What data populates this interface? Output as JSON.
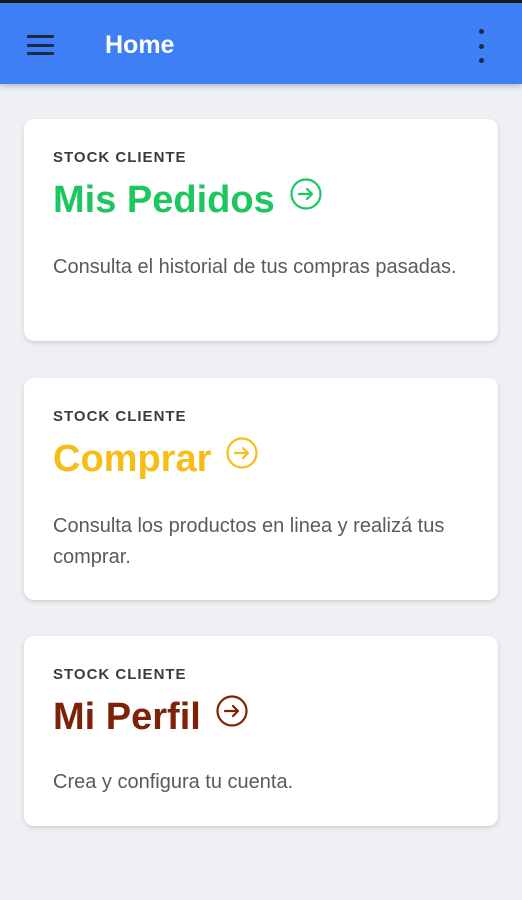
{
  "header": {
    "title": "Home"
  },
  "colors": {
    "appbar": "#3f7ff6",
    "green": "#1ec660",
    "yellow": "#f7bd16",
    "brown": "#7d2208"
  },
  "cards": [
    {
      "overline": "STOCK CLIENTE",
      "title": "Mis Pedidos",
      "description": "Consulta el historial de tus compras pasadas.",
      "color": "#1ec660",
      "icon": "arrow-right-circle-icon"
    },
    {
      "overline": "STOCK CLIENTE",
      "title": "Comprar",
      "description": "Consulta los productos en linea y realizá tus comprar.",
      "color": "#f7bd16",
      "icon": "arrow-right-circle-icon"
    },
    {
      "overline": "STOCK CLIENTE",
      "title": "Mi Perfil",
      "description": "Crea y configura tu cuenta.",
      "color": "#7d2208",
      "icon": "arrow-right-circle-icon"
    }
  ]
}
